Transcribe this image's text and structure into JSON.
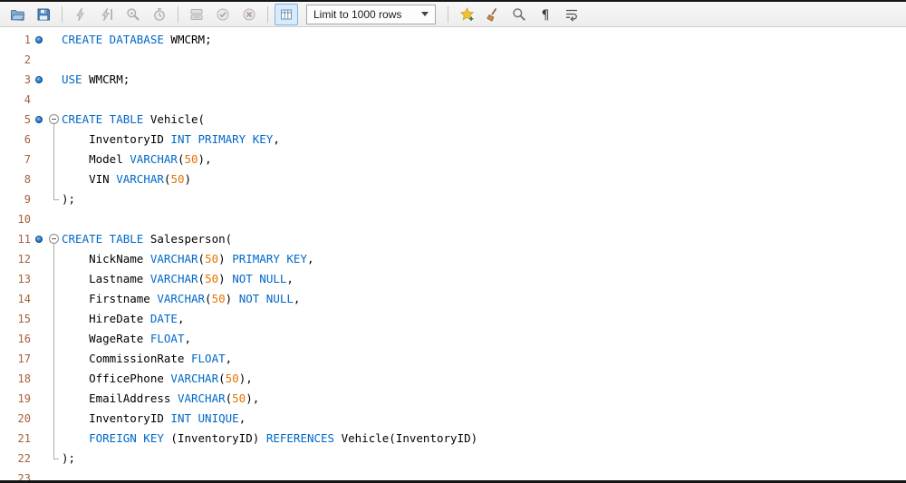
{
  "colors": {
    "keyword": "#0068c8",
    "number": "#e17400",
    "identifier": "#000000",
    "line_number": "#a6603a",
    "statement_marker": "#2e7cc9",
    "toolbar_background": "#f0f0f0"
  },
  "toolbar": {
    "limit_dropdown_label": "Limit to 1000 rows",
    "items": [
      {
        "kind": "icon",
        "name": "open-script-icon",
        "disabled": false,
        "pressed": false
      },
      {
        "kind": "icon",
        "name": "save-script-icon",
        "disabled": false,
        "pressed": false
      },
      {
        "kind": "sep"
      },
      {
        "kind": "icon",
        "name": "execute-icon",
        "disabled": true,
        "pressed": false
      },
      {
        "kind": "icon",
        "name": "execute-current-statement-icon",
        "disabled": true,
        "pressed": false
      },
      {
        "kind": "icon",
        "name": "explain-icon",
        "disabled": true,
        "pressed": false
      },
      {
        "kind": "icon",
        "name": "stop-execution-icon",
        "disabled": true,
        "pressed": false
      },
      {
        "kind": "sep"
      },
      {
        "kind": "icon",
        "name": "stop-on-error-icon",
        "disabled": true,
        "pressed": false
      },
      {
        "kind": "icon",
        "name": "commit-icon",
        "disabled": true,
        "pressed": false
      },
      {
        "kind": "icon",
        "name": "rollback-icon",
        "disabled": true,
        "pressed": false
      },
      {
        "kind": "sep"
      },
      {
        "kind": "icon",
        "name": "auto-commit-toggle-icon",
        "disabled": false,
        "pressed": true
      },
      {
        "kind": "dropdown",
        "name": "limit-rows-dropdown",
        "label": "Limit to 1000 rows"
      },
      {
        "kind": "sep"
      },
      {
        "kind": "icon",
        "name": "save-snippet-icon",
        "disabled": false,
        "pressed": false
      },
      {
        "kind": "icon",
        "name": "beautify-script-icon",
        "disabled": false,
        "pressed": false
      },
      {
        "kind": "icon",
        "name": "find-icon",
        "disabled": false,
        "pressed": false
      },
      {
        "kind": "icon",
        "name": "invisible-characters-icon",
        "disabled": false,
        "pressed": false
      },
      {
        "kind": "icon",
        "name": "wrap-text-icon",
        "disabled": false,
        "pressed": false
      }
    ]
  },
  "editor": {
    "lines": [
      {
        "n": 1,
        "marker": true,
        "fold": "",
        "code": [
          [
            "kw",
            "CREATE DATABASE "
          ],
          [
            "id",
            "WMCRM"
          ],
          [
            "pl",
            ";"
          ]
        ]
      },
      {
        "n": 2,
        "marker": false,
        "fold": "",
        "code": []
      },
      {
        "n": 3,
        "marker": true,
        "fold": "",
        "code": [
          [
            "kw",
            "USE "
          ],
          [
            "id",
            "WMCRM"
          ],
          [
            "pl",
            ";"
          ]
        ]
      },
      {
        "n": 4,
        "marker": false,
        "fold": "",
        "code": []
      },
      {
        "n": 5,
        "marker": true,
        "fold": "start",
        "code": [
          [
            "kw",
            "CREATE TABLE "
          ],
          [
            "id",
            "Vehicle"
          ],
          [
            "pl",
            "("
          ]
        ]
      },
      {
        "n": 6,
        "marker": false,
        "fold": "mid",
        "code": [
          [
            "id",
            "    InventoryID "
          ],
          [
            "kw",
            "INT PRIMARY KEY"
          ],
          [
            "pl",
            ","
          ]
        ]
      },
      {
        "n": 7,
        "marker": false,
        "fold": "mid",
        "code": [
          [
            "id",
            "    Model "
          ],
          [
            "kw",
            "VARCHAR"
          ],
          [
            "pl",
            "("
          ],
          [
            "num",
            "50"
          ],
          [
            "pl",
            "),"
          ]
        ]
      },
      {
        "n": 8,
        "marker": false,
        "fold": "mid",
        "code": [
          [
            "id",
            "    VIN "
          ],
          [
            "kw",
            "VARCHAR"
          ],
          [
            "pl",
            "("
          ],
          [
            "num",
            "50"
          ],
          [
            "pl",
            ")"
          ]
        ]
      },
      {
        "n": 9,
        "marker": false,
        "fold": "end",
        "code": [
          [
            "pl",
            ");"
          ]
        ]
      },
      {
        "n": 10,
        "marker": false,
        "fold": "",
        "code": []
      },
      {
        "n": 11,
        "marker": true,
        "fold": "start",
        "code": [
          [
            "kw",
            "CREATE TABLE "
          ],
          [
            "id",
            "Salesperson"
          ],
          [
            "pl",
            "("
          ]
        ]
      },
      {
        "n": 12,
        "marker": false,
        "fold": "mid",
        "code": [
          [
            "id",
            "    NickName "
          ],
          [
            "kw",
            "VARCHAR"
          ],
          [
            "pl",
            "("
          ],
          [
            "num",
            "50"
          ],
          [
            "pl",
            ") "
          ],
          [
            "kw",
            "PRIMARY KEY"
          ],
          [
            "pl",
            ","
          ]
        ]
      },
      {
        "n": 13,
        "marker": false,
        "fold": "mid",
        "code": [
          [
            "id",
            "    Lastname "
          ],
          [
            "kw",
            "VARCHAR"
          ],
          [
            "pl",
            "("
          ],
          [
            "num",
            "50"
          ],
          [
            "pl",
            ") "
          ],
          [
            "kw",
            "NOT NULL"
          ],
          [
            "pl",
            ","
          ]
        ]
      },
      {
        "n": 14,
        "marker": false,
        "fold": "mid",
        "code": [
          [
            "id",
            "    Firstname "
          ],
          [
            "kw",
            "VARCHAR"
          ],
          [
            "pl",
            "("
          ],
          [
            "num",
            "50"
          ],
          [
            "pl",
            ") "
          ],
          [
            "kw",
            "NOT NULL"
          ],
          [
            "pl",
            ","
          ]
        ]
      },
      {
        "n": 15,
        "marker": false,
        "fold": "mid",
        "code": [
          [
            "id",
            "    HireDate "
          ],
          [
            "kw",
            "DATE"
          ],
          [
            "pl",
            ","
          ]
        ]
      },
      {
        "n": 16,
        "marker": false,
        "fold": "mid",
        "code": [
          [
            "id",
            "    WageRate "
          ],
          [
            "kw",
            "FLOAT"
          ],
          [
            "pl",
            ","
          ]
        ]
      },
      {
        "n": 17,
        "marker": false,
        "fold": "mid",
        "code": [
          [
            "id",
            "    CommissionRate "
          ],
          [
            "kw",
            "FLOAT"
          ],
          [
            "pl",
            ","
          ]
        ]
      },
      {
        "n": 18,
        "marker": false,
        "fold": "mid",
        "code": [
          [
            "id",
            "    OfficePhone "
          ],
          [
            "kw",
            "VARCHAR"
          ],
          [
            "pl",
            "("
          ],
          [
            "num",
            "50"
          ],
          [
            "pl",
            "),"
          ]
        ]
      },
      {
        "n": 19,
        "marker": false,
        "fold": "mid",
        "code": [
          [
            "id",
            "    EmailAddress "
          ],
          [
            "kw",
            "VARCHAR"
          ],
          [
            "pl",
            "("
          ],
          [
            "num",
            "50"
          ],
          [
            "pl",
            "),"
          ]
        ]
      },
      {
        "n": 20,
        "marker": false,
        "fold": "mid",
        "code": [
          [
            "id",
            "    InventoryID "
          ],
          [
            "kw",
            "INT UNIQUE"
          ],
          [
            "pl",
            ","
          ]
        ]
      },
      {
        "n": 21,
        "marker": false,
        "fold": "mid",
        "code": [
          [
            "kw",
            "    FOREIGN KEY "
          ],
          [
            "pl",
            "("
          ],
          [
            "id",
            "InventoryID"
          ],
          [
            "pl",
            ") "
          ],
          [
            "kw",
            "REFERENCES "
          ],
          [
            "id",
            "Vehicle"
          ],
          [
            "pl",
            "("
          ],
          [
            "id",
            "InventoryID"
          ],
          [
            "pl",
            ")"
          ]
        ]
      },
      {
        "n": 22,
        "marker": false,
        "fold": "end",
        "code": [
          [
            "pl",
            ");"
          ]
        ]
      },
      {
        "n": 23,
        "marker": false,
        "fold": "",
        "code": []
      }
    ]
  }
}
